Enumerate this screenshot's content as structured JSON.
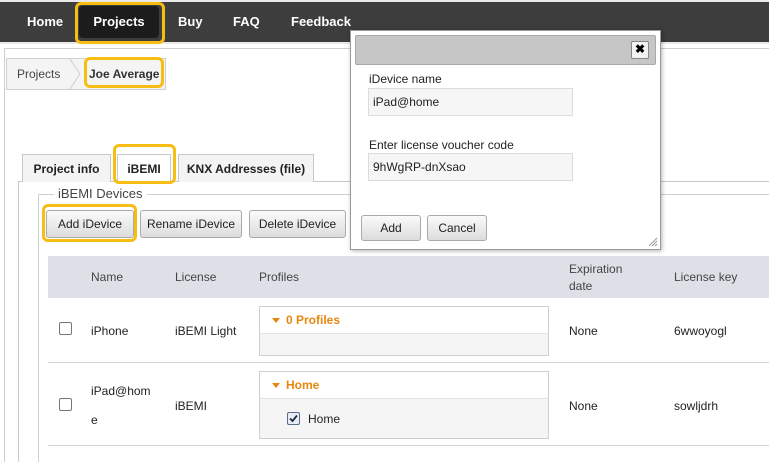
{
  "nav": {
    "items": [
      {
        "label": "Home"
      },
      {
        "label": "Projects"
      },
      {
        "label": "Buy"
      },
      {
        "label": "FAQ"
      },
      {
        "label": "Feedback"
      }
    ]
  },
  "breadcrumb": {
    "items": [
      {
        "label": "Projects"
      },
      {
        "label": "Joe Average"
      }
    ]
  },
  "tabs": [
    {
      "label": "Project info"
    },
    {
      "label": "iBEMI"
    },
    {
      "label": "KNX Addresses (file)"
    }
  ],
  "section": {
    "legend": "iBEMI Devices",
    "buttons": {
      "add": "Add iDevice",
      "rename": "Rename iDevice",
      "delete": "Delete iDevice"
    }
  },
  "table": {
    "columns": {
      "name": "Name",
      "license": "License",
      "profiles": "Profiles",
      "expiration_line1": "Expiration",
      "expiration_line2": "date",
      "license_key": "License key"
    },
    "rows": [
      {
        "name": "iPhone",
        "license": "iBEMI Light",
        "profiles_header": "0 Profiles",
        "expiration": "None",
        "license_key": "6wwoyogl"
      },
      {
        "name_line1": "iPad@hom",
        "name_line2": "e",
        "license": "iBEMI",
        "profiles_header": "Home",
        "profile_item": "Home",
        "expiration": "None",
        "license_key": "sowljdrh"
      }
    ]
  },
  "dialog": {
    "name_label": "iDevice name",
    "name_value": "iPad@home",
    "voucher_label": "Enter license voucher code",
    "voucher_value": "9hWgRP-dnXsao",
    "add_button": "Add",
    "cancel_button": "Cancel",
    "close_glyph": "✖"
  },
  "colors": {
    "highlight": "#f7bd12",
    "navbar": "#3d3d3d",
    "accent": "#e8870f"
  }
}
